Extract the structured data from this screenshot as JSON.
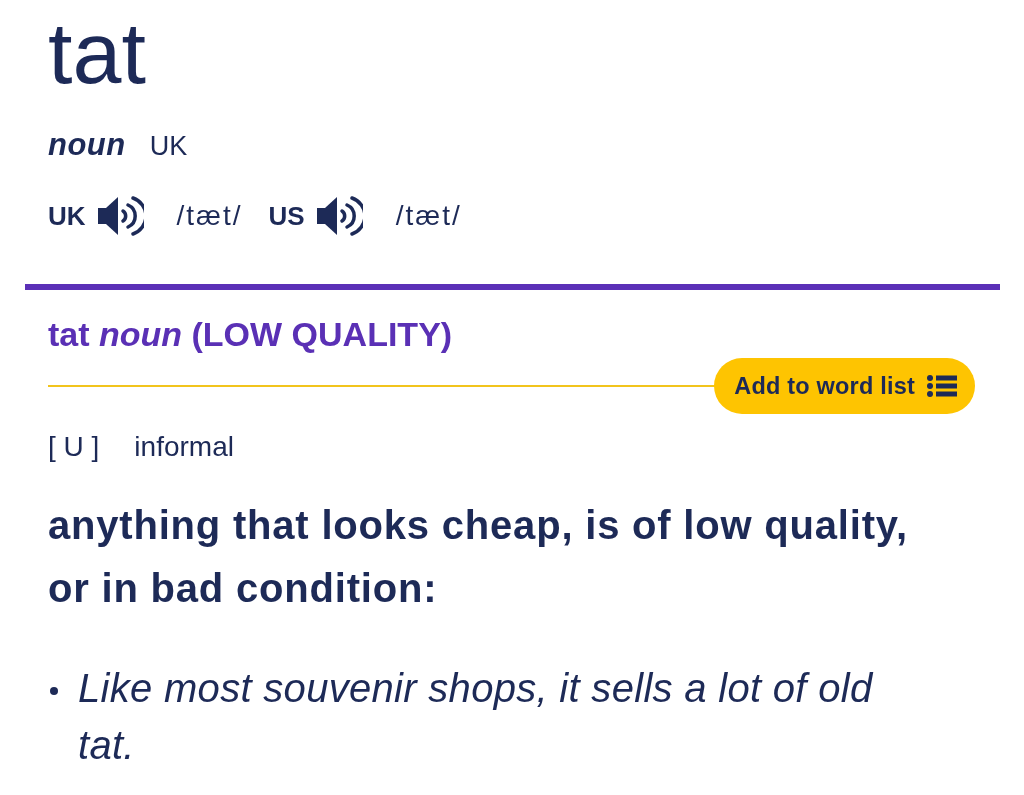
{
  "headword": "tat",
  "part_of_speech": "noun",
  "region": "UK",
  "pronunciations": [
    {
      "region": "UK",
      "ipa": "/tæt/"
    },
    {
      "region": "US",
      "ipa": "/tæt/"
    }
  ],
  "sense": {
    "heading": "tat *noun* (LOW QUALITY)",
    "word_list_button": "Add to word list",
    "grammar_code": "[ U ]",
    "usage": "informal",
    "definition": "anything that looks cheap, is of low quality, or in bad condition:",
    "examples": [
      "Like most souvenir shops, it sells a lot of old tat."
    ]
  }
}
